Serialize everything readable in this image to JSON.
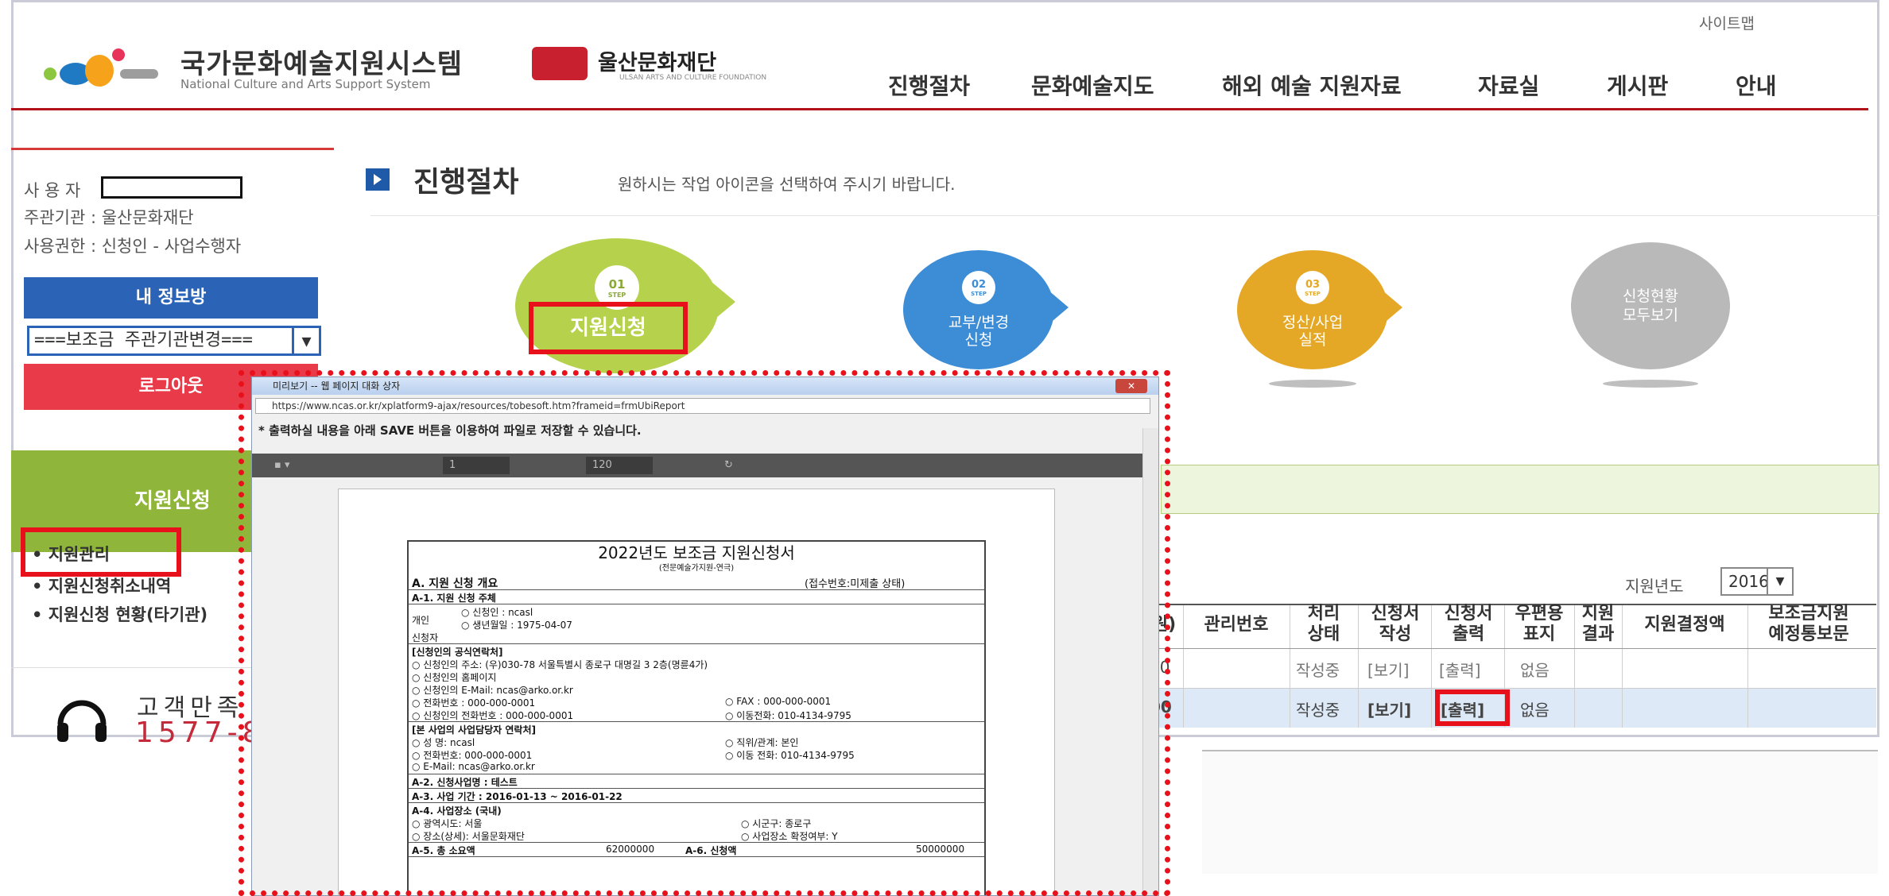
{
  "header": {
    "sitemap": "사이트맵",
    "logo_title": "국가문화예술지원시스템",
    "logo_sub": "National Culture and Arts Support System",
    "seal_text": "울산문화\n재단",
    "partner": "울산문화재단",
    "partner_sub": "ULSAN ARTS AND CULTURE FOUNDATION",
    "nav": [
      "진행절차",
      "문화예술지도",
      "해외 예술 지원자료",
      "자료실",
      "게시판",
      "안내"
    ]
  },
  "sidebar": {
    "user_label": "사 용 자",
    "org_line": "주관기관 : 울산문화재단",
    "role_line": "사용권한 : 신청인 - 사업수행자",
    "info_button": "내 정보방",
    "org_select_value": "===보조금 주관기관변경===",
    "logout_button": "로그아웃",
    "menu_title": "지원신청",
    "menu_items": [
      "• 지원관리",
      "• 지원신청취소내역",
      "• 지원신청 현황(타기관)"
    ],
    "cs_title": "고객만족",
    "cs_phone": "1577-8"
  },
  "main": {
    "title": "진행절차",
    "desc": "원하시는 작업 아이콘을 선택하여 주시기 바랍니다.",
    "steps": [
      {
        "num": "01",
        "step": "STEP",
        "label": "지원신청"
      },
      {
        "num": "02",
        "step": "STEP",
        "label": "교부/변경\n신청"
      },
      {
        "num": "03",
        "step": "STEP",
        "label": "정산/사업\n실적"
      },
      {
        "label": "신청현황\n모두보기"
      }
    ],
    "year_label": "지원년도",
    "year_value": "2016",
    "table": {
      "headers": [
        "원)",
        "관리번호",
        "처리\n상태",
        "신청서\n작성",
        "신청서\n출력",
        "우편용\n표지",
        "지원\n결과",
        "지원결정액",
        "보조금지원\n예정통보문"
      ],
      "rows": [
        {
          "amount": "00",
          "status": "작성중",
          "view": "[보기]",
          "print": "[출력]",
          "cover": "없음"
        },
        {
          "amount": "00",
          "status": "작성중",
          "view": "[보기]",
          "print": "[출력]",
          "cover": "없음"
        }
      ]
    }
  },
  "popup": {
    "title": "미리보기 -- 웹 페이지 대화 상자",
    "url": "https://www.ncas.or.kr/xplatform9-ajax/resources/tobesoft.htm?frameid=frmUbiReport",
    "save_notice": "* 출력하실 내용을 아래 SAVE 버튼을 이용하여 파일로 저장할 수 있습니다.",
    "page_value": "1",
    "zoom_value": "120",
    "doc": {
      "title": "2022년도 보조금 지원신청서",
      "subtitle": "(전문예술가지원-연극)",
      "sec_a": "A. 지원 신청 개요",
      "receipt": "(접수번호:미제출 상태)",
      "a1": "A-1. 지원 신청 주체",
      "individual": "개인",
      "applicant_label": "신청자",
      "applicant_name": "○ 신청인 :        ncasl",
      "birth": "○ 생년월일 :       1975-04-07",
      "official_contact": "[신청인의 공식연락처]",
      "address": "○ 신청인의 주소:     (우)030-78 서울특별시 종로구 대명길 3 2층(명륜4가)",
      "homepage": "○ 신청인의 홈페이지",
      "email": "○ 신청인의 E-Mail:    ncas@arko.or.kr",
      "phone": "○ 전화번호 :   000-000-0001",
      "fax": "○ FAX :              000-000-0001",
      "tel2": "○ 신청인의 전화번호 :   000-000-0001",
      "mobile": "○ 이동전화:      010-4134-9795",
      "manager": "[본 사업의 사업담당자 연락처]",
      "mgr_name": "○ 성    명:     ncasl",
      "mgr_role": "○ 직위/관계:      본인",
      "mgr_phone": "○ 전화번호:     000-000-0001",
      "mgr_mobile": "○ 이동 전화:      010-4134-9795",
      "mgr_email": "○ E-Mail:      ncas@arko.or.kr",
      "a2": "A-2. 신청사업명 :     테스트",
      "a3": "A-3. 사업 기간 :    2016-01-13 ~ 2016-01-22",
      "a4": "A-4. 사업장소   (국내)",
      "city": "○ 광역시도:      서울",
      "district": "○ 시군구:    종로구",
      "place": "○ 장소(상세):   서울문화재단",
      "confirm": "○ 사업장소 확정여부:   Y",
      "a5": "A-5. 총 소요액",
      "a5_value": "62000000",
      "a6": "A-6. 신청액",
      "a6_value": "50000000"
    }
  }
}
